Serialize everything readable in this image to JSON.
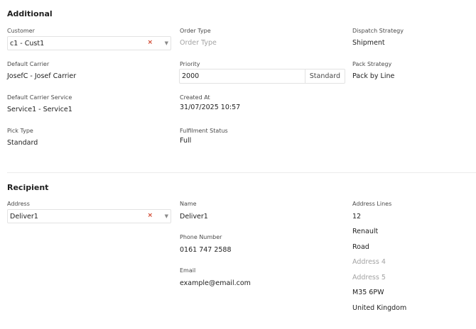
{
  "additional": {
    "title": "Additional",
    "customer": {
      "label": "Customer",
      "value": "c1 - Cust1",
      "clear": "×",
      "caret": "▼"
    },
    "order_type": {
      "label": "Order Type",
      "placeholder": "Order Type"
    },
    "dispatch_strategy": {
      "label": "Dispatch Strategy",
      "value": "Shipment"
    },
    "default_carrier": {
      "label": "Default Carrier",
      "value": "JosefC - Josef Carrier"
    },
    "priority": {
      "label": "Priority",
      "value": "2000",
      "unit": "Standard"
    },
    "pack_strategy": {
      "label": "Pack Strategy",
      "value": "Pack by Line"
    },
    "default_carrier_service": {
      "label": "Default Carrier Service",
      "value": "Service1 - Service1"
    },
    "created_at": {
      "label": "Created At",
      "value": "31/07/2025 10:57"
    },
    "pick_type": {
      "label": "Pick Type",
      "value": "Standard"
    },
    "fulfilment_status": {
      "label": "Fulfilment Status",
      "value": "Full"
    }
  },
  "recipient": {
    "title": "Recipient",
    "address": {
      "label": "Address",
      "value": "Deliver1",
      "clear": "×",
      "caret": "▼"
    },
    "name": {
      "label": "Name",
      "value": "Deliver1"
    },
    "phone": {
      "label": "Phone Number",
      "value": "0161 747 2588"
    },
    "email": {
      "label": "Email",
      "value": "example@email.com"
    },
    "address_lines": {
      "label": "Address Lines",
      "line1": "12",
      "line2": "Renault",
      "line3": "Road",
      "line4_placeholder": "Address 4",
      "line5_placeholder": "Address 5",
      "postcode": "M35 6PW",
      "country": "United Kingdom"
    }
  }
}
